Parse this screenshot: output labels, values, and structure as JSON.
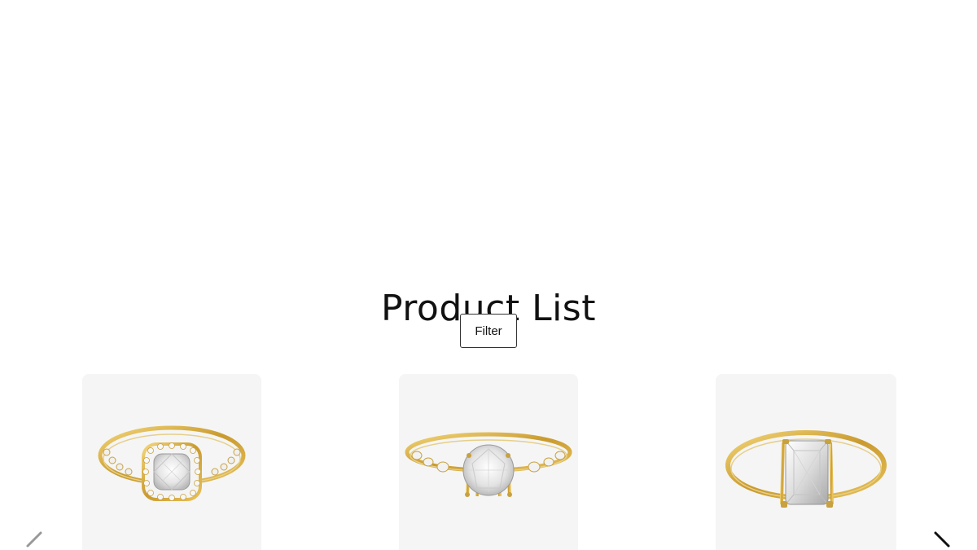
{
  "page": {
    "title": "Product List"
  },
  "toolbar": {
    "filter_label": "Filter"
  },
  "products": [
    {
      "image": "cushion-halo-engagement-ring",
      "metal_color": "#d9b44a"
    },
    {
      "image": "round-vintage-engagement-ring",
      "metal_color": "#d9b44a"
    },
    {
      "image": "radiant-solitaire-engagement-ring",
      "metal_color": "#d9b44a"
    }
  ],
  "carousel": {
    "prev_icon": "chevron-left-icon",
    "next_icon": "chevron-right-icon"
  }
}
